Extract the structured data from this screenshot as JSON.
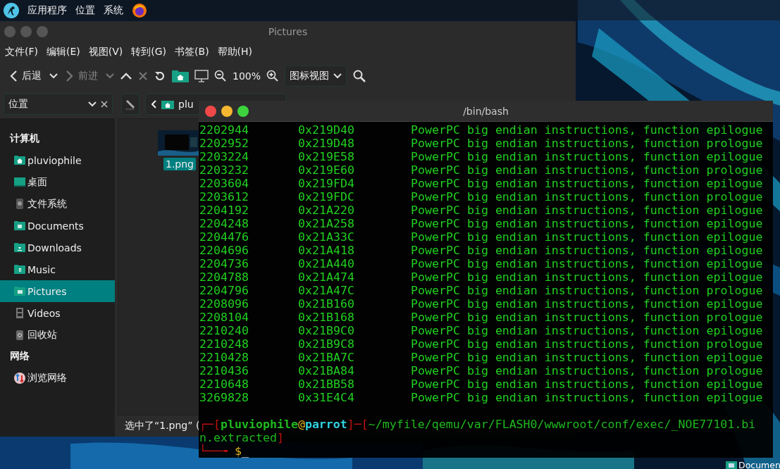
{
  "top_panel": {
    "menus": [
      "应用程序",
      "位置",
      "系统"
    ]
  },
  "file_manager": {
    "title": "Pictures",
    "menu": [
      "文件(F)",
      "编辑(E)",
      "视图(V)",
      "转到(G)",
      "书签(B)",
      "帮助(H)"
    ],
    "toolbar": {
      "back": "后退",
      "forward": "前进",
      "forward_disabled": true,
      "zoom": "100%",
      "view_mode": "图标视图"
    },
    "location": {
      "label": "位置",
      "path": "plu"
    },
    "sidebar": [
      {
        "heading": "计算机",
        "items": [
          {
            "label": "pluviophile",
            "kind": "home",
            "selected": false
          },
          {
            "label": "桌面",
            "kind": "desktop",
            "selected": false
          },
          {
            "label": "文件系统",
            "kind": "drive",
            "selected": false
          },
          {
            "label": "Documents",
            "kind": "documents",
            "selected": false
          },
          {
            "label": "Downloads",
            "kind": "downloads",
            "selected": false
          },
          {
            "label": "Music",
            "kind": "music",
            "selected": false
          },
          {
            "label": "Pictures",
            "kind": "pictures",
            "selected": true
          },
          {
            "label": "Videos",
            "kind": "videos",
            "selected": false
          },
          {
            "label": "回收站",
            "kind": "trash",
            "selected": false
          }
        ]
      },
      {
        "heading": "网络",
        "items": [
          {
            "label": "浏览网络",
            "kind": "network",
            "selected": false
          }
        ]
      }
    ],
    "files": [
      {
        "name": "1.png",
        "selected": true
      }
    ],
    "status": "选中了“1.png” ("
  },
  "terminal": {
    "title": "/bin/bash",
    "rows": [
      {
        "decimal": "2202944",
        "hex": "0x219D40",
        "description": "PowerPC big endian instructions, function epilogue"
      },
      {
        "decimal": "2202952",
        "hex": "0x219D48",
        "description": "PowerPC big endian instructions, function prologue"
      },
      {
        "decimal": "2203224",
        "hex": "0x219E58",
        "description": "PowerPC big endian instructions, function epilogue"
      },
      {
        "decimal": "2203232",
        "hex": "0x219E60",
        "description": "PowerPC big endian instructions, function prologue"
      },
      {
        "decimal": "2203604",
        "hex": "0x219FD4",
        "description": "PowerPC big endian instructions, function epilogue"
      },
      {
        "decimal": "2203612",
        "hex": "0x219FDC",
        "description": "PowerPC big endian instructions, function prologue"
      },
      {
        "decimal": "2204192",
        "hex": "0x21A220",
        "description": "PowerPC big endian instructions, function epilogue"
      },
      {
        "decimal": "2204248",
        "hex": "0x21A258",
        "description": "PowerPC big endian instructions, function epilogue"
      },
      {
        "decimal": "2204476",
        "hex": "0x21A33C",
        "description": "PowerPC big endian instructions, function epilogue"
      },
      {
        "decimal": "2204696",
        "hex": "0x21A418",
        "description": "PowerPC big endian instructions, function epilogue"
      },
      {
        "decimal": "2204736",
        "hex": "0x21A440",
        "description": "PowerPC big endian instructions, function epilogue"
      },
      {
        "decimal": "2204788",
        "hex": "0x21A474",
        "description": "PowerPC big endian instructions, function epilogue"
      },
      {
        "decimal": "2204796",
        "hex": "0x21A47C",
        "description": "PowerPC big endian instructions, function prologue"
      },
      {
        "decimal": "2208096",
        "hex": "0x21B160",
        "description": "PowerPC big endian instructions, function epilogue"
      },
      {
        "decimal": "2208104",
        "hex": "0x21B168",
        "description": "PowerPC big endian instructions, function prologue"
      },
      {
        "decimal": "2210240",
        "hex": "0x21B9C0",
        "description": "PowerPC big endian instructions, function epilogue"
      },
      {
        "decimal": "2210248",
        "hex": "0x21B9C8",
        "description": "PowerPC big endian instructions, function prologue"
      },
      {
        "decimal": "2210428",
        "hex": "0x21BA7C",
        "description": "PowerPC big endian instructions, function epilogue"
      },
      {
        "decimal": "2210436",
        "hex": "0x21BA84",
        "description": "PowerPC big endian instructions, function prologue"
      },
      {
        "decimal": "2210648",
        "hex": "0x21BB58",
        "description": "PowerPC big endian instructions, function epilogue"
      },
      {
        "decimal": "3269828",
        "hex": "0x31E4C4",
        "description": "PowerPC big endian instructions, function epilogue"
      }
    ],
    "prompt": {
      "open": "┌─[",
      "user": "pluviophile",
      "at": "@",
      "host": "parrot",
      "separator": "]─[",
      "path": "~/myfile/qemu/var/FLASH0/wwwroot/conf/exec/_NOE77101.bin.extracted",
      "close": "]",
      "corner": "└──╼ ",
      "symbol": "$",
      "cursor": "_"
    }
  },
  "desktop_icons": [
    {
      "label": "Documen"
    }
  ]
}
